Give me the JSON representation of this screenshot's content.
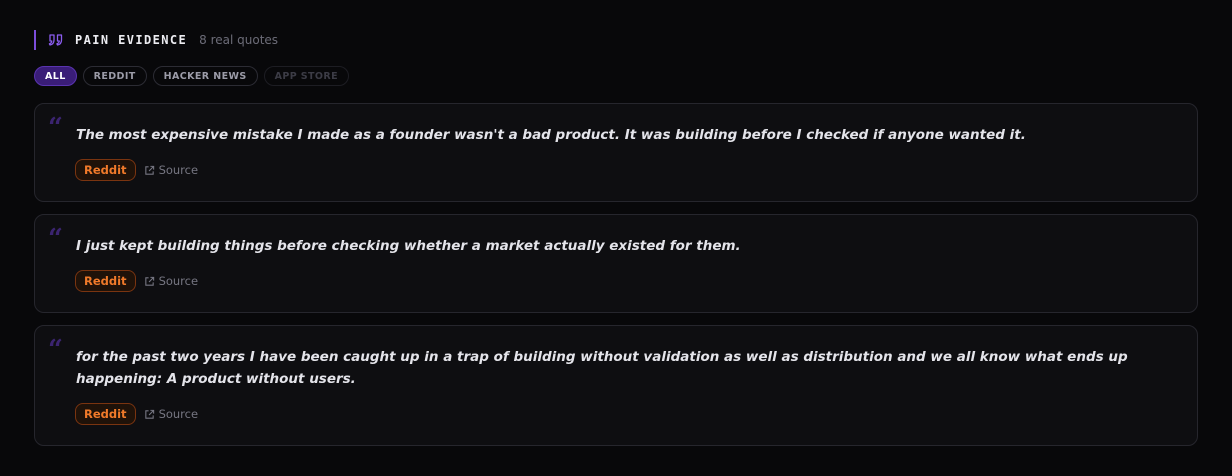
{
  "header": {
    "title": "PAIN EVIDENCE",
    "count": "8 real quotes",
    "icon": "quote-icon"
  },
  "filters": [
    {
      "label": "ALL",
      "state": "active"
    },
    {
      "label": "REDDIT",
      "state": "normal"
    },
    {
      "label": "HACKER NEWS",
      "state": "normal"
    },
    {
      "label": "APP STORE",
      "state": "disabled"
    }
  ],
  "quotes": [
    {
      "text": "The most expensive mistake I made as a founder wasn't a bad product. It was building before I checked if anyone wanted it.",
      "platform": "Reddit",
      "source_label": "Source"
    },
    {
      "text": "I just kept building things before checking whether a market actually existed for them.",
      "platform": "Reddit",
      "source_label": "Source"
    },
    {
      "text": "for the past two years I have been caught up in a trap of building without validation as well as distribution and we all know what ends up happening: A product without users.",
      "platform": "Reddit",
      "source_label": "Source"
    }
  ],
  "colors": {
    "accent": "#7c4ddb",
    "platform_reddit": "#f07a2a",
    "background": "#08080a"
  }
}
